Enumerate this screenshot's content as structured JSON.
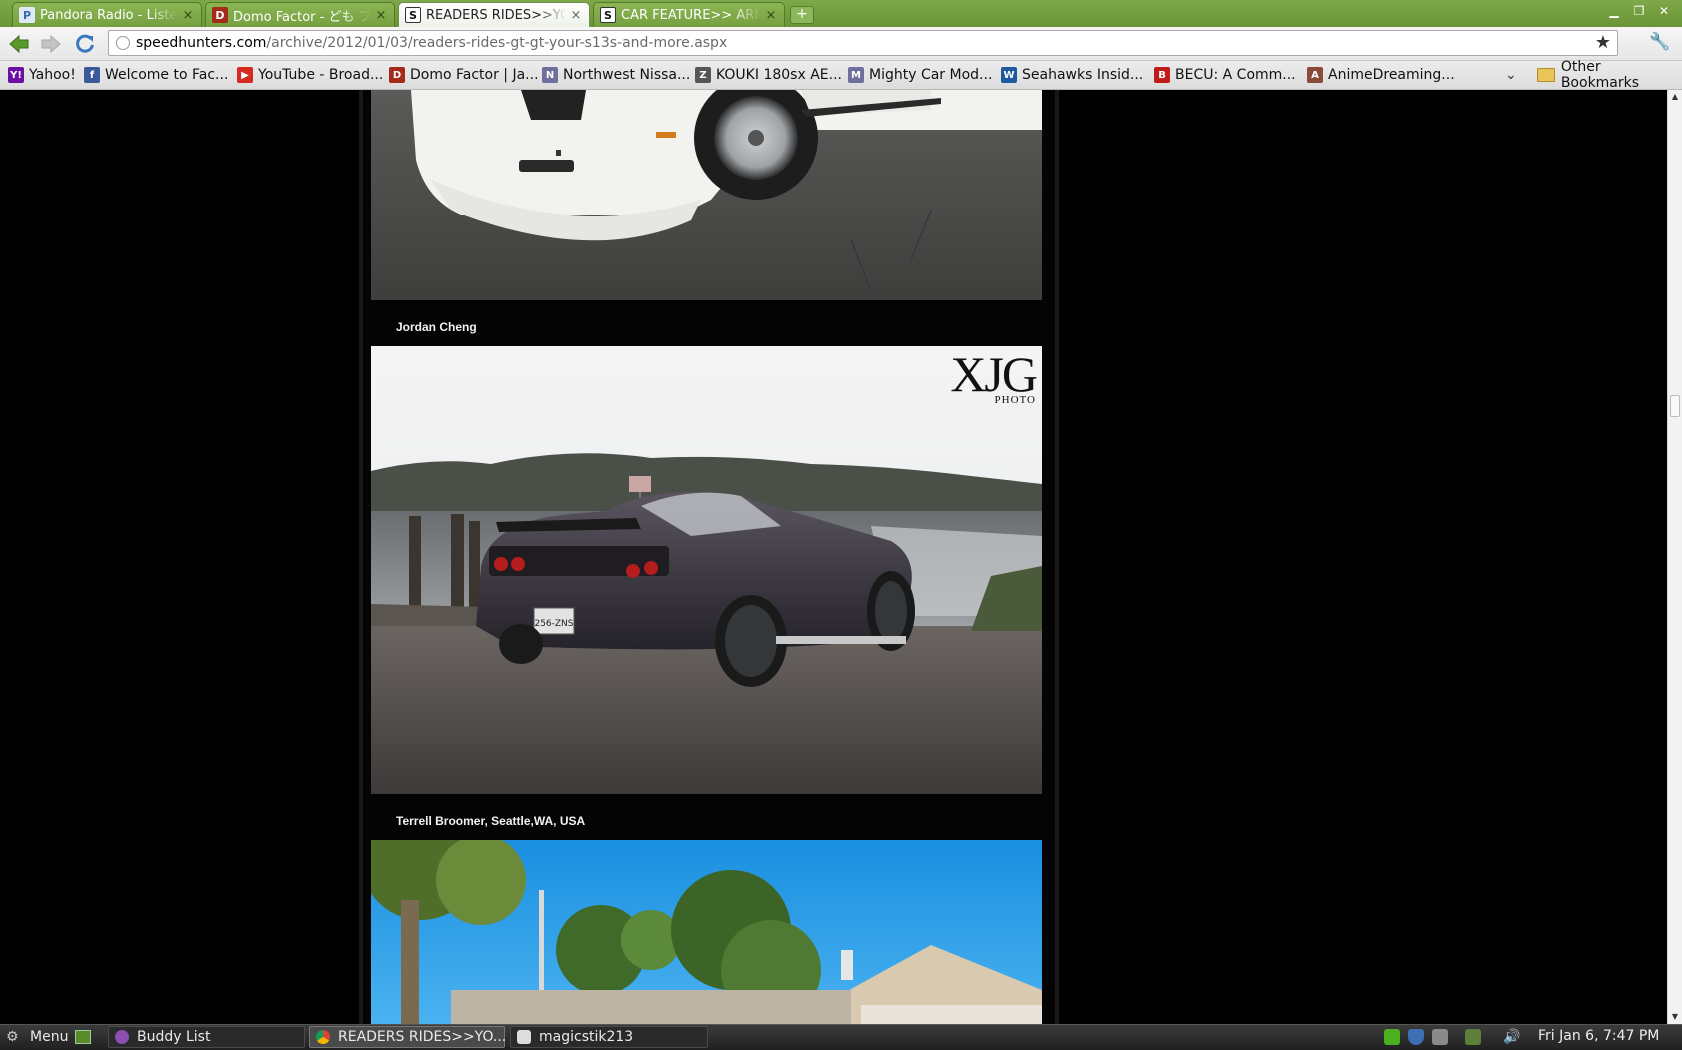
{
  "browser": {
    "tabs": [
      {
        "title": "Pandora Radio - Listen to",
        "favicon": "P",
        "favicon_color": "#3668b0",
        "active": false
      },
      {
        "title": "Domo Factor - ども ファクター",
        "favicon": "D",
        "favicon_color": "#a42a1c",
        "active": false
      },
      {
        "title": "READERS RIDES>>YOUR",
        "favicon": "S",
        "favicon_color": "#111111",
        "active": true
      },
      {
        "title": "CAR FEATURE>> ARMS",
        "favicon": "S",
        "favicon_color": "#111111",
        "active": false
      }
    ],
    "new_tab_label": "+",
    "url_domain": "speedhunters.com",
    "url_path": "/archive/2012/01/03/readers-rides-gt-gt-your-s13s-and-more.aspx",
    "bookmarks": [
      {
        "label": "Yahoo!",
        "icon": "Y!",
        "color": "#6b0fa5"
      },
      {
        "label": "Welcome to Fac...",
        "icon": "f",
        "color": "#3b5998"
      },
      {
        "label": "YouTube - Broad...",
        "icon": "▶",
        "color": "#d62a20"
      },
      {
        "label": "Domo Factor | Ja...",
        "icon": "D",
        "color": "#a42a1c"
      },
      {
        "label": "Northwest Nissa...",
        "icon": "N",
        "color": "#6f6f9e"
      },
      {
        "label": "KOUKI 180sx AE...",
        "icon": "Z",
        "color": "#555555"
      },
      {
        "label": "Mighty Car Mod...",
        "icon": "M",
        "color": "#6f6f9e"
      },
      {
        "label": "Seahawks Insid...",
        "icon": "W",
        "color": "#1f5aa0"
      },
      {
        "label": "BECU: A Comm...",
        "icon": "B",
        "color": "#c01a1a"
      },
      {
        "label": "AnimeDreaming...",
        "icon": "A",
        "color": "#8a4a3a"
      }
    ],
    "other_bookmarks": "Other Bookmarks"
  },
  "page": {
    "captions": [
      "Jordan Cheng",
      "Terrell Broomer, Seattle,WA, USA"
    ],
    "watermark_main": "XJG",
    "watermark_sub": "PHOTO",
    "plate_text": "256-ZNS"
  },
  "taskbar": {
    "menu_label": "Menu",
    "windows": [
      {
        "label": "Buddy List",
        "active": false
      },
      {
        "label": "READERS RIDES>>YO...",
        "active": true
      },
      {
        "label": "magicstik213",
        "active": false
      }
    ],
    "clock": "Fri Jan  6,  7:47 PM"
  },
  "colors": {
    "tab_strip": "#7fa84a",
    "page_background": "#000000",
    "caption_text": "#f2f2f2"
  }
}
